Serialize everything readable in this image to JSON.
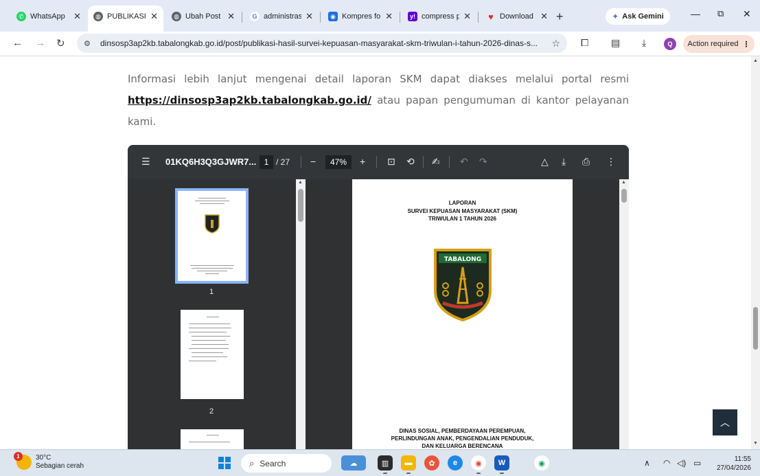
{
  "browser": {
    "tabs": [
      {
        "label": "WhatsApp",
        "icon": "whatsapp-icon",
        "color": "#25d366"
      },
      {
        "label": "PUBLIKASI",
        "icon": "globe-icon",
        "color": "#5f6368"
      },
      {
        "label": "Ubah Post",
        "icon": "globe-icon",
        "color": "#5f6368"
      },
      {
        "label": "administrasi",
        "icon": "google-icon",
        "color": "#4285f4"
      },
      {
        "label": "Kompres fo",
        "icon": "compress-icon",
        "color": "#1e6fd9"
      },
      {
        "label": "compress p",
        "icon": "yahoo-icon",
        "color": "#6001d2"
      },
      {
        "label": "Download",
        "icon": "heart-icon",
        "color": "#d93025"
      }
    ],
    "new_tab": "+",
    "gemini_label": "Ask Gemini",
    "url": "dinsosp3ap2kb.tabalongkab.go.id/post/publikasi-hasil-survei-kepuasan-masyarakat-skm-triwulan-i-tahun-2026-dinas-s...",
    "profile_initial": "Q",
    "action_required": "Action required"
  },
  "article": {
    "text_before": "Informasi lebih lanjut mengenai detail laporan SKM dapat diakses melalui portal resmi ",
    "link": "https://dinsosp3ap2kb.tabalongkab.go.id/",
    "text_after": " atau papan pengumuman di kantor pelayanan kami."
  },
  "pdf": {
    "filename": "01KQ6H3Q3GJWR7...",
    "current_page": "1",
    "total_pages": "/ 27",
    "zoom": "47%",
    "thumb_labels": [
      "1",
      "2"
    ],
    "doc": {
      "heading": "LAPORAN",
      "title": "SURVEI KEPUASAN MASYARAKAT (SKM)",
      "period": "TRIWULAN 1 TAHUN 2026",
      "emblem_text": "TABALONG",
      "footer_1": "DINAS SOSIAL, PEMBERDAYAAN PEREMPUAN,",
      "footer_2": "PERLINDUNGAN ANAK, PENGENDALIAN PENDUDUK,",
      "footer_3": "DAN KELUARGA BERENCANA"
    }
  },
  "taskbar": {
    "temperature": "30°C",
    "weather": "Sebagian cerah",
    "weather_badge": "1",
    "search": "Search",
    "time": "11:55",
    "date": "27/04/2026"
  }
}
